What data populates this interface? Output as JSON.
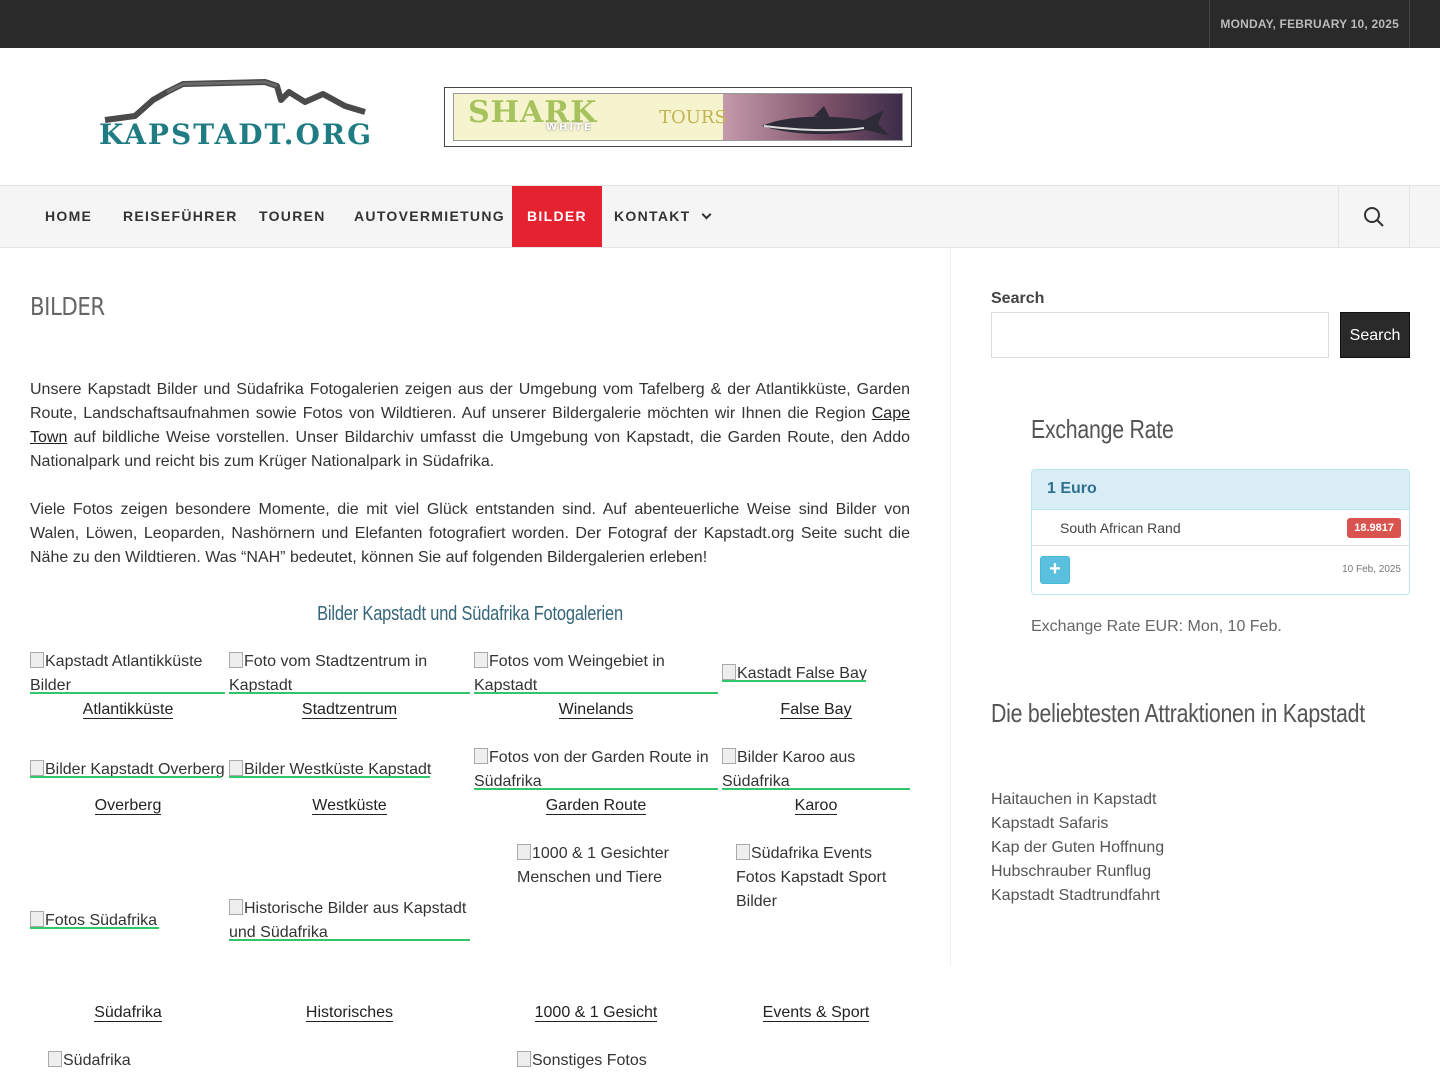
{
  "topbar": {
    "date": "MONDAY, FEBRUARY 10, 2025"
  },
  "header": {
    "logo_text": "KAPSTADT.ORG",
    "banner": {
      "word1": "SHARK",
      "word2": "WHITE",
      "word3": "TOURS"
    }
  },
  "nav": {
    "items": [
      {
        "label": "HOME"
      },
      {
        "label": "REISEFÜHRER"
      },
      {
        "label": "TOUREN"
      },
      {
        "label": "AUTOVERMIETUNG"
      },
      {
        "label": "BILDER"
      },
      {
        "label": "KONTAKT"
      }
    ],
    "active": "BILDER",
    "search_icon": "search-icon"
  },
  "content": {
    "title": "BILDER",
    "para1_a": "Unsere Kapstadt Bilder und Südafrika Fotogalerien zeigen aus der Umgebung vom Tafelberg & der Atlantikküste, Garden Route, Landschaftsaufnahmen sowie Fotos von Wildtieren. Auf unserer Bildergalerie möchten wir Ihnen die Region ",
    "para1_link": "Cape Town",
    "para1_b": " auf bildliche Weise vorstellen. Unser Bildarchiv umfasst die Umgebung von Kapstadt, die Garden Route, den Addo Nationalpark und reicht bis zum Krüger Nationalpark in Südafrika.",
    "para2": "Viele Fotos zeigen besondere Momente, die mit viel Glück entstanden sind. Auf abenteuerliche Weise sind Bilder von Walen, Löwen, Leoparden, Nashörnern und Elefanten fotografiert worden. Der Fotograf der Kapstadt.org Seite sucht die Nähe zu den Wildtieren. Was “NAH” bedeutet, können Sie auf folgenden Bildergalerien erleben!",
    "gallery_heading": "Bilder Kapstadt und Südafrika Fotogalerien",
    "gallery": {
      "alt_atlantik_1": "Kapstadt Atlantikküste",
      "alt_atlantik_2": "Bilder",
      "alt_stadt_1": "Foto vom Stadtzentrum in",
      "alt_stadt_2": "Kapstadt",
      "alt_wein_1": "Fotos vom Weingebiet in",
      "alt_wein_2": "Kapstadt",
      "alt_false": "Kastadt False Bay",
      "alt_overberg": "Bilder Kapstadt Overberg",
      "alt_west": "Bilder Westküste Kapstadt",
      "alt_garden_1": "Fotos von der Garden Route in",
      "alt_garden_2": "Südafrika",
      "alt_karoo_1": "Bilder Karoo aus",
      "alt_karoo_2": "Südafrika",
      "alt_1000_1": "1000 & 1 Gesichter",
      "alt_1000_2": "Menschen und Tiere",
      "alt_events_1": "Südafrika Events",
      "alt_events_2": "Fotos Kapstadt Sport",
      "alt_events_3": "Bilder",
      "alt_sa": "Fotos Südafrika",
      "alt_hist_1": "Historische Bilder aus Kapstadt",
      "alt_hist_2": "und Südafrika",
      "alt_bottom_1": "Südafrika",
      "alt_bottom_2": "Sonstiges Fotos",
      "captions": {
        "atlantik": "Atlantikküste",
        "stadt": "Stadtzentrum",
        "wein": "Winelands",
        "false": "False Bay",
        "overberg": "Overberg",
        "west": "Westküste",
        "garden": "Garden Route",
        "karoo": "Karoo",
        "sa": "Südafrika",
        "hist": "Historisches",
        "g1000": "1000 & 1 Gesicht",
        "events": "Events & Sport"
      }
    }
  },
  "sidebar": {
    "search_label": "Search",
    "search_placeholder": "",
    "search_button": "Search",
    "exchange_heading": "Exchange Rate",
    "fx": {
      "base": "1 Euro",
      "currency": "South African Rand",
      "rate": "18.9817",
      "date": "10 Feb, 2025",
      "plus": "+"
    },
    "exchange_note": "Exchange Rate EUR: Mon, 10 Feb.",
    "attractions_heading": "Die beliebtesten Attraktionen in Kapstadt",
    "attractions": [
      "Haitauchen in Kapstadt",
      "Kapstadt Safaris",
      "Kap der Guten Hoffnung",
      "Hubschrauber Runflug",
      "Kapstadt Stadtrundfahrt"
    ]
  },
  "colors": {
    "topbar": "#2a2a2a",
    "nav_active": "#e5222f",
    "link_underline": "#32c66a",
    "gallery_heading": "#35657a",
    "fx_badge": "#d9534f",
    "fx_head": "#d9edf7"
  }
}
